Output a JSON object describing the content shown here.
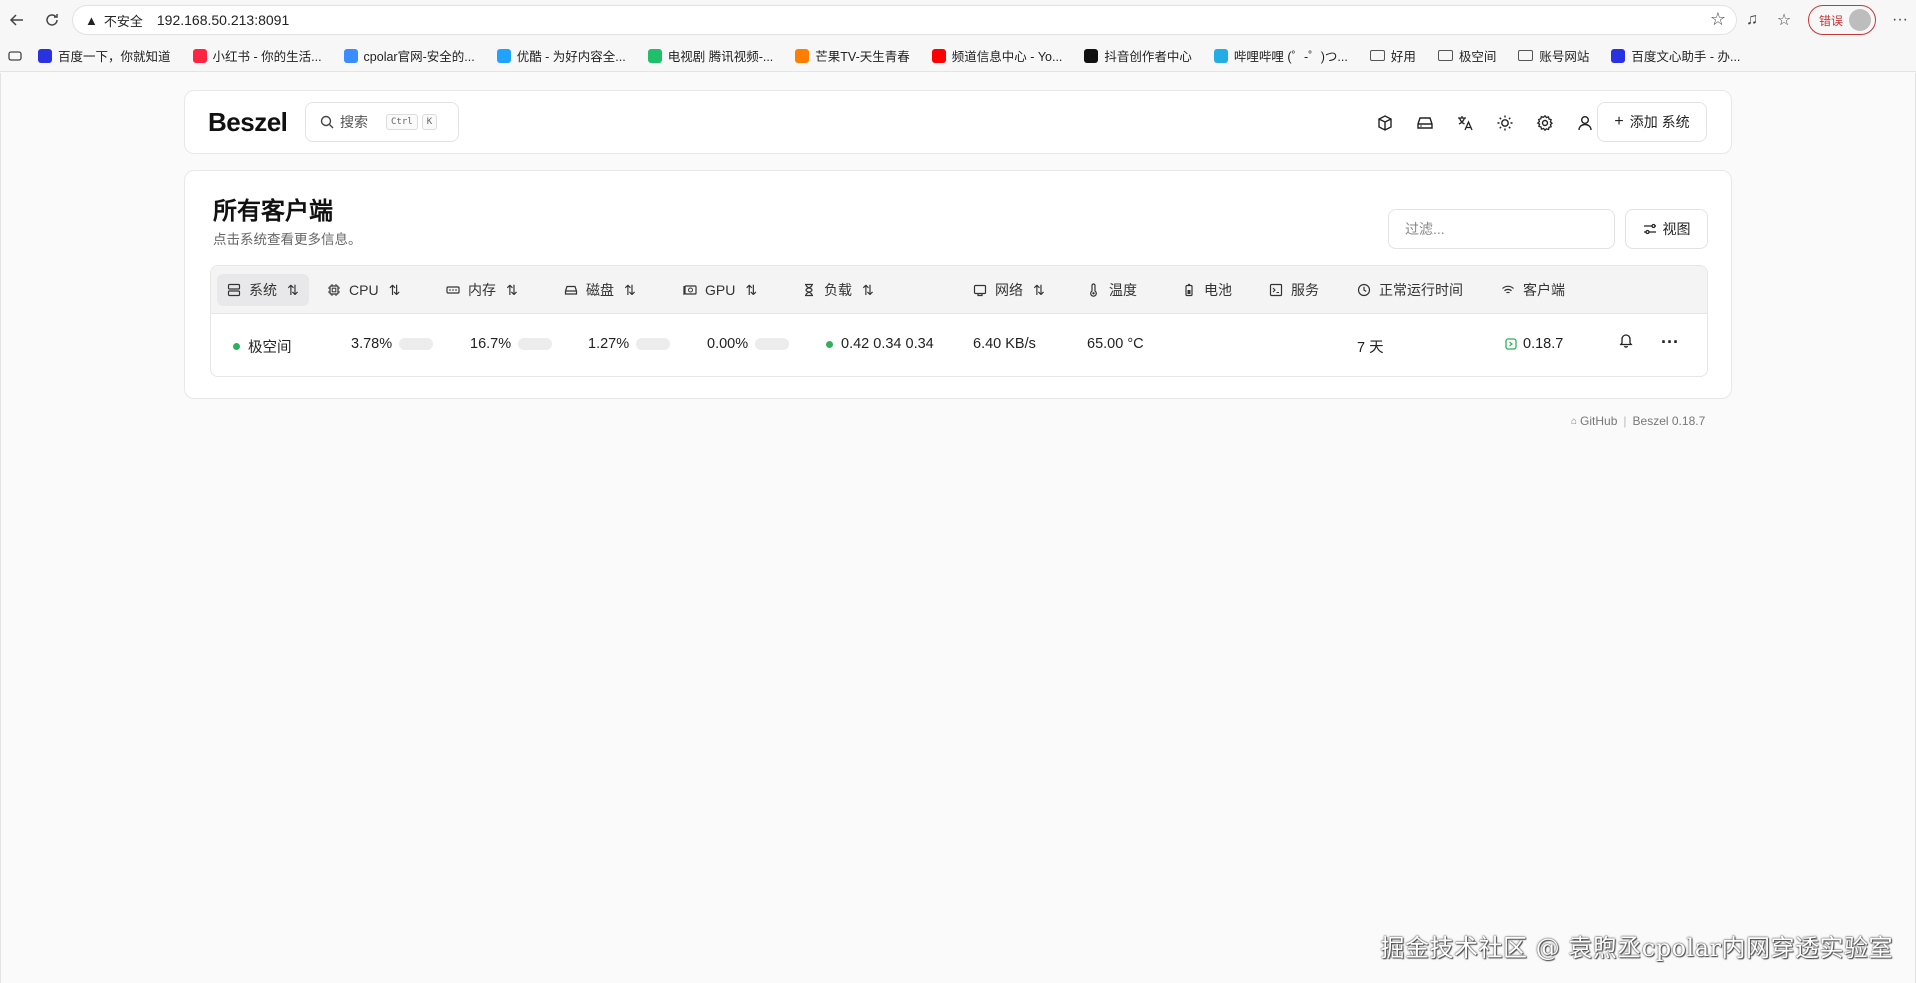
{
  "browser": {
    "security_label": "不安全",
    "url": "192.168.50.213:8091",
    "error_label": "错误"
  },
  "bookmarks": [
    {
      "label": "百度一下，你就知道",
      "color": "#2932e1"
    },
    {
      "label": "小红书 - 你的生活...",
      "color": "#ff2442"
    },
    {
      "label": "cpolar官网-安全的...",
      "color": "#3b8cff"
    },
    {
      "label": "优酷 - 为好内容全...",
      "color": "#1fa3ff"
    },
    {
      "label": "电视剧 腾讯视频-...",
      "color": "#20c06a"
    },
    {
      "label": "芒果TV-天生青春",
      "color": "#ff7e00"
    },
    {
      "label": "频道信息中心 - Yo...",
      "color": "#ff0000"
    },
    {
      "label": "抖音创作者中心",
      "color": "#111111"
    },
    {
      "label": "哔哩哔哩 (゜-゜)つ...",
      "color": "#23ade5"
    },
    {
      "label": "好用",
      "folder": true
    },
    {
      "label": "极空间",
      "folder": true
    },
    {
      "label": "账号网站",
      "folder": true
    },
    {
      "label": "百度文心助手 - 办...",
      "color": "#2932e1"
    }
  ],
  "app": {
    "logo": "Beszel",
    "search_label": "搜索",
    "search_kbd_1": "Ctrl",
    "search_kbd_2": "K",
    "add_system_label": "添加 系统"
  },
  "card": {
    "title": "所有客户端",
    "subtitle": "点击系统查看更多信息。",
    "filter_placeholder": "过滤...",
    "view_label": "视图"
  },
  "table": {
    "headers": {
      "system": "系统",
      "cpu": "CPU",
      "memory": "内存",
      "disk": "磁盘",
      "gpu": "GPU",
      "load": "负载",
      "network": "网络",
      "temperature": "温度",
      "battery": "电池",
      "services": "服务",
      "uptime": "正常运行时间",
      "agent": "客户端"
    },
    "row": {
      "name": "极空间",
      "cpu": "3.78%",
      "cpu_pct": 3.78,
      "memory": "16.7%",
      "memory_pct": 16.7,
      "disk": "1.27%",
      "disk_pct": 1.27,
      "gpu": "0.00%",
      "gpu_pct": 0,
      "load": "0.42 0.34 0.34",
      "network": "6.40 KB/s",
      "temperature": "65.00 °C",
      "uptime": "7 天",
      "agent": "0.18.7"
    }
  },
  "footer": {
    "github": "GitHub",
    "version": "Beszel 0.18.7"
  },
  "watermark": "掘金技术社区 @ 袁煦丞cpolar内网穿透实验室",
  "colors": {
    "status_green": "#2eb15a",
    "error_red": "#c63838"
  }
}
